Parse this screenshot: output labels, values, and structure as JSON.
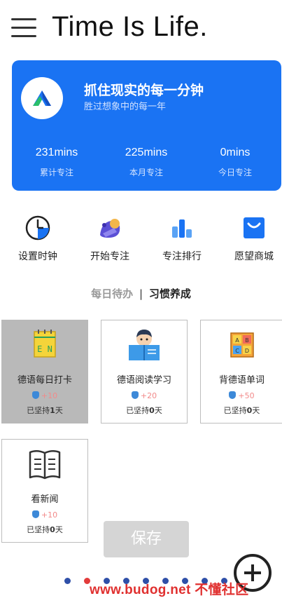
{
  "header": {
    "title": "Time Is Life."
  },
  "profile": {
    "motto": "抓住现实的每一分钟",
    "submotto": "胜过想象中的每一年",
    "stats": [
      {
        "value": "231mins",
        "label": "累计专注"
      },
      {
        "value": "225mins",
        "label": "本月专注"
      },
      {
        "value": "0mins",
        "label": "今日专注"
      }
    ]
  },
  "quick_actions": [
    {
      "label": "设置时钟",
      "icon": "clock-icon"
    },
    {
      "label": "开始专注",
      "icon": "focus-illustration-icon"
    },
    {
      "label": "专注排行",
      "icon": "bar-chart-icon"
    },
    {
      "label": "愿望商城",
      "icon": "shopping-bag-icon"
    }
  ],
  "segments": {
    "daily": "每日待办",
    "separator": "|",
    "habits": "习惯养成"
  },
  "habits": [
    {
      "name": "德语每日打卡",
      "reward": "+10",
      "streak_prefix": "已坚持",
      "streak_days": "1",
      "streak_suffix": "天",
      "icon": "notebook-en-icon",
      "icon_text": "E N",
      "active": true
    },
    {
      "name": "德语阅读学习",
      "reward": "+20",
      "streak_prefix": "已坚持",
      "streak_days": "0",
      "streak_suffix": "天",
      "icon": "reading-boy-icon"
    },
    {
      "name": "背德语单词",
      "reward": "+50",
      "streak_prefix": "已坚持",
      "streak_days": "0",
      "streak_suffix": "天",
      "icon": "abcd-blocks-icon"
    },
    {
      "name": "看新闻",
      "reward": "+10",
      "streak_prefix": "已坚持",
      "streak_days": "0",
      "streak_suffix": "天",
      "icon": "open-book-icon"
    }
  ],
  "save_label": "保存",
  "pagination": {
    "count": 9,
    "active_index": 1
  },
  "watermark": "www.budog.net 不懂社区",
  "colors": {
    "accent": "#1a73f3",
    "reward": "#f28a8a",
    "active_dot": "#e23b3b",
    "dot": "#2e4fa8"
  }
}
